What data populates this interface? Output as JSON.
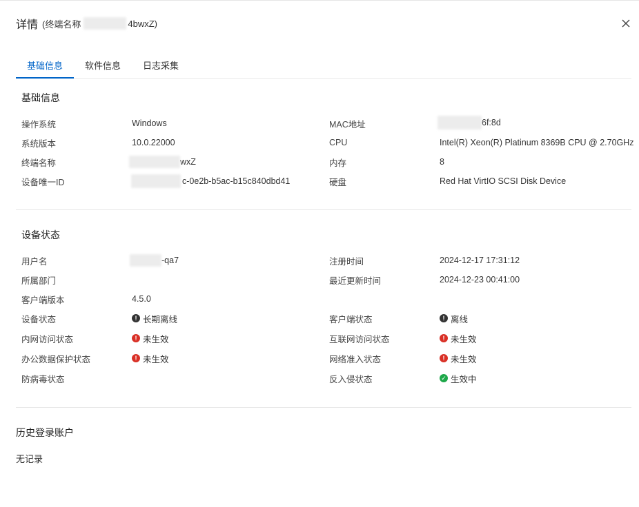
{
  "header": {
    "title": "详情",
    "subtitle_prefix": "(终端名称",
    "subtitle_suffix": "4bwxZ)"
  },
  "tabs": [
    {
      "label": "基础信息",
      "active": true
    },
    {
      "label": "软件信息",
      "active": false
    },
    {
      "label": "日志采集",
      "active": false
    }
  ],
  "basic": {
    "title": "基础信息",
    "left": [
      {
        "label": "操作系统",
        "value": "Windows"
      },
      {
        "label": "系统版本",
        "value": "10.0.22000"
      },
      {
        "label": "终端名称",
        "value": "wxZ"
      },
      {
        "label": "设备唯一ID",
        "value": "c-0e2b-b5ac-b15c840dbd41"
      }
    ],
    "right": [
      {
        "label": "MAC地址",
        "value": "6f:8d"
      },
      {
        "label": "CPU",
        "value": "Intel(R) Xeon(R) Platinum 8369B CPU @ 2.70GHz"
      },
      {
        "label": "内存",
        "value": "8"
      },
      {
        "label": "硬盘",
        "value": "Red Hat VirtIO SCSI Disk Device"
      }
    ]
  },
  "status": {
    "title": "设备状态",
    "left": [
      {
        "label": "用户名",
        "value": "-qa7"
      },
      {
        "label": "所属部门",
        "value": ""
      },
      {
        "label": "客户端版本",
        "value": "4.5.0"
      },
      {
        "label": "设备状态",
        "value": "长期离线",
        "icon": "dark-alert-icon"
      },
      {
        "label": "内网访问状态",
        "value": "未生效",
        "icon": "red-alert-icon"
      },
      {
        "label": "办公数据保护状态",
        "value": "未生效",
        "icon": "red-alert-icon"
      },
      {
        "label": "防病毒状态",
        "value": ""
      }
    ],
    "right": [
      {
        "label": "注册时间",
        "value": "2024-12-17 17:31:12"
      },
      {
        "label": "最近更新时间",
        "value": "2024-12-23 00:41:00"
      },
      {
        "label": "",
        "value": ""
      },
      {
        "label": "客户端状态",
        "value": "离线",
        "icon": "dark-alert-icon"
      },
      {
        "label": "互联网访问状态",
        "value": "未生效",
        "icon": "red-alert-icon"
      },
      {
        "label": "网络准入状态",
        "value": "未生效",
        "icon": "red-alert-icon"
      },
      {
        "label": "反入侵状态",
        "value": "生效中",
        "icon": "green-check-icon"
      }
    ]
  },
  "history": {
    "title": "历史登录账户",
    "empty_text": "无记录"
  },
  "colors": {
    "accent": "#0064c8",
    "alert_red": "#d93026",
    "ok_green": "#1ea84a",
    "offline_dark": "#333333"
  }
}
